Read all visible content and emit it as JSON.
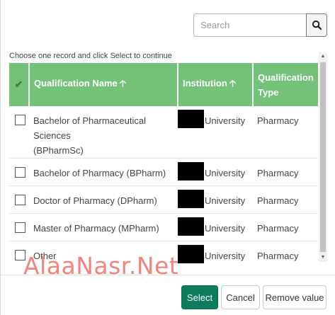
{
  "search": {
    "placeholder": "Search",
    "value": "",
    "button_icon": "search-icon"
  },
  "hint": "Choose one record and click Select to continue",
  "table": {
    "columns": [
      {
        "label": "",
        "icon": "checkmark-icon"
      },
      {
        "label": "Qualification Name",
        "sort": "ascending"
      },
      {
        "label": "Institution",
        "sort": "ascending"
      },
      {
        "label_line1": "Qualification",
        "label_line2": "Type"
      }
    ],
    "sort_arrow": "🡡",
    "header_check": "✔",
    "rows": [
      {
        "name_line1": "Bachelor of Pharmaceutical Sciences",
        "name_line2": "(BPharmSc)",
        "institution": "University",
        "type": "Pharmacy"
      },
      {
        "name_line1": "Bachelor of Pharmacy (BPharm)",
        "name_line2": "",
        "institution": "University",
        "type": "Pharmacy"
      },
      {
        "name_line1": "Doctor of Pharmacy (DPharm)",
        "name_line2": "",
        "institution": "University",
        "type": "Pharmacy"
      },
      {
        "name_line1": "Master of Pharmacy (MPharm)",
        "name_line2": "",
        "institution": "University",
        "type": "Pharmacy"
      },
      {
        "name_line1": "Other",
        "name_line2": "",
        "institution": "University",
        "type": "Pharmacy"
      }
    ]
  },
  "watermark": "AlaaNasr.Net",
  "buttons": {
    "select": "Select",
    "cancel": "Cancel",
    "remove": "Remove value"
  },
  "colors": {
    "header_green": "#74c27a",
    "select_button": "#0e7a5e",
    "watermark": "#f2847c"
  }
}
